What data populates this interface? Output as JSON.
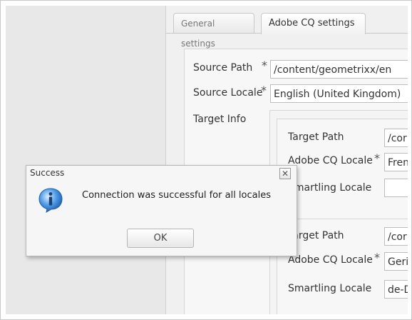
{
  "tabs": {
    "general": "General settings",
    "adobe_cq": "Adobe CQ settings"
  },
  "form": {
    "source_path": {
      "label": "Source Path",
      "required": "*",
      "value": "/content/geometrixx/en"
    },
    "source_locale": {
      "label": "Source Locale",
      "required": "*",
      "value": "English (United Kingdom)"
    },
    "target_info_label": "Target Info",
    "targets": [
      {
        "target_path_label": "Target Path",
        "target_path_value": "/cor",
        "cq_locale_label": "Adobe CQ Locale",
        "cq_locale_required": "*",
        "cq_locale_value": "Fren",
        "smartling_locale_label": "Smartling Locale",
        "smartling_locale_value": ""
      },
      {
        "target_path_label": "Target Path",
        "target_path_value": "/cor",
        "cq_locale_label": "Adobe CQ Locale",
        "cq_locale_required": "*",
        "cq_locale_value": "Geri",
        "smartling_locale_label": "Smartling Locale",
        "smartling_locale_value": "de-D"
      }
    ]
  },
  "dialog": {
    "title": "Success",
    "close_glyph": "✕",
    "message": "Connection was successful for all locales",
    "ok_label": "OK",
    "icon": "info-icon"
  },
  "colors": {
    "icon_blue": "#2f7fd0",
    "left_pane": "#e8e8e8"
  }
}
